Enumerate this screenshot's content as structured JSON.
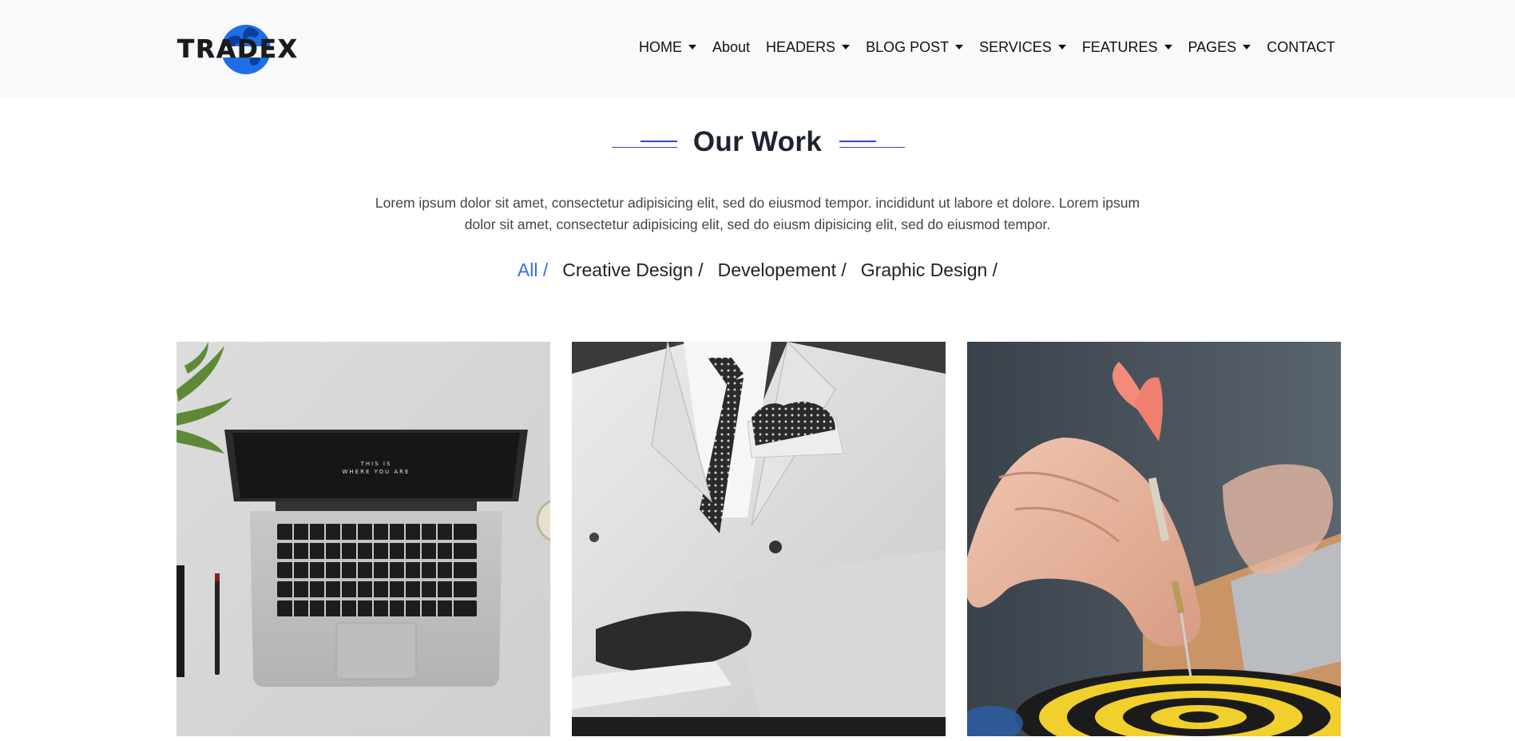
{
  "brand": {
    "name": "TRADEX",
    "accent_color": "#1d6ee8"
  },
  "nav": {
    "items": [
      {
        "label": "HOME",
        "dropdown": true
      },
      {
        "label": "About",
        "dropdown": false
      },
      {
        "label": "HEADERS",
        "dropdown": true
      },
      {
        "label": "BLOG POST",
        "dropdown": true
      },
      {
        "label": "SERVICES",
        "dropdown": true
      },
      {
        "label": "FEATURES",
        "dropdown": true
      },
      {
        "label": "PAGES",
        "dropdown": true
      },
      {
        "label": "CONTACT",
        "dropdown": false
      }
    ]
  },
  "section": {
    "title": "Our Work",
    "intro_line1": "Lorem ipsum dolor sit amet, consectetur adipisicing elit, sed do eiusmod tempor. incididunt ut labore et dolore. Lorem ipsum",
    "intro_line2": "dolor sit amet, consectetur adipisicing elit, sed do eiusm dipisicing elit, sed do eiusmod tempor.",
    "heading_line_color": "#3440d6",
    "active_filter_color": "#2f6fe0"
  },
  "filters": [
    {
      "label": "All /",
      "active": true
    },
    {
      "label": "Creative Design /",
      "active": false
    },
    {
      "label": "Developement /",
      "active": false
    },
    {
      "label": "Graphic Design /",
      "active": false
    }
  ],
  "portfolio": {
    "items": [
      {
        "subject": "laptop-on-desk",
        "screen_text_1": "THIS IS",
        "screen_text_2": "WHERE YOU ARE"
      },
      {
        "subject": "man-in-white-suit"
      },
      {
        "subject": "hand-throwing-dart"
      }
    ]
  }
}
